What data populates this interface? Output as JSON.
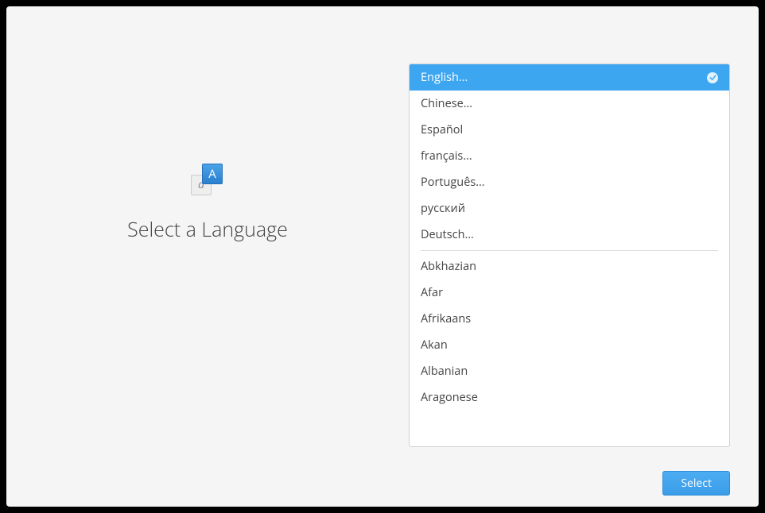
{
  "heading": "Select a Language",
  "primary_languages": [
    {
      "label": "English…",
      "selected": true
    },
    {
      "label": "Chinese…",
      "selected": false
    },
    {
      "label": "Español",
      "selected": false
    },
    {
      "label": "français…",
      "selected": false
    },
    {
      "label": "Português…",
      "selected": false
    },
    {
      "label": "русский",
      "selected": false
    },
    {
      "label": "Deutsch…",
      "selected": false
    }
  ],
  "secondary_languages": [
    {
      "label": "Abkhazian"
    },
    {
      "label": "Afar"
    },
    {
      "label": "Afrikaans"
    },
    {
      "label": "Akan"
    },
    {
      "label": "Albanian"
    },
    {
      "label": "Aragonese"
    }
  ],
  "select_button": "Select",
  "icon_back_char": "a",
  "icon_front_char": "A"
}
